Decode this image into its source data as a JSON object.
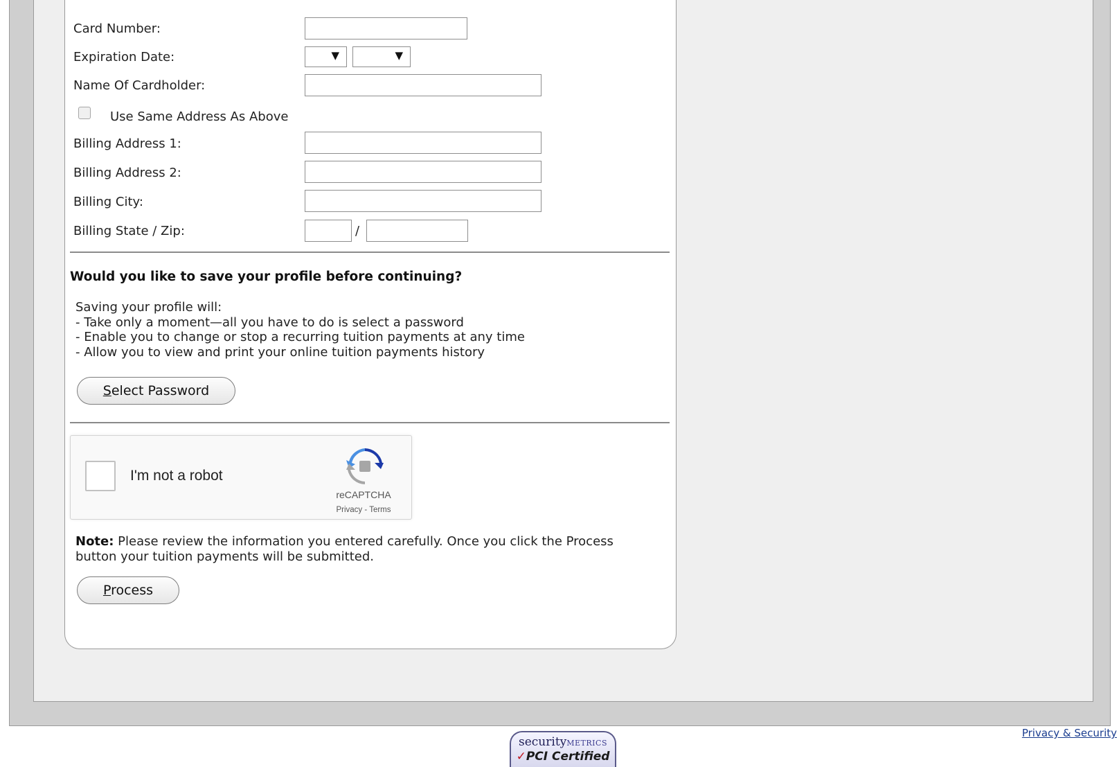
{
  "form": {
    "card_number_label": "Card Number:",
    "card_number_value": "",
    "expiration_date_label": "Expiration Date:",
    "expiration_month_value": "",
    "expiration_year_value": "",
    "cardholder_name_label": "Name Of Cardholder:",
    "cardholder_name_value": "",
    "same_address_label": "Use Same Address As Above",
    "same_address_checked": false,
    "billing_address1_label": "Billing Address 1:",
    "billing_address1_value": "",
    "billing_address2_label": "Billing Address 2:",
    "billing_address2_value": "",
    "billing_city_label": "Billing City:",
    "billing_city_value": "",
    "billing_state_zip_label": "Billing State / Zip:",
    "billing_state_value": "",
    "billing_zip_value": "",
    "state_zip_separator": "/",
    "dropdown_arrow": "▼"
  },
  "profile": {
    "heading": "Would you like to save your profile before continuing?",
    "intro": "Saving your profile will:",
    "benefits": [
      "- Take only a moment—all you have to do is select a password",
      "- Enable you to change or stop a recurring tuition payments at any time",
      "- Allow you to view and print your online tuition payments history"
    ],
    "button_accesskey": "S",
    "button_rest": "elect Password"
  },
  "recaptcha": {
    "label": "I'm not a robot",
    "brand": "reCAPTCHA",
    "links": "Privacy - Terms",
    "icon": "recaptcha-logo"
  },
  "note": {
    "bold": "Note:",
    "text": " Please review the information you entered carefully. Once you click the Process button your tuition payments will be submitted."
  },
  "process_button": {
    "accesskey": "P",
    "rest": "rocess"
  },
  "footer": {
    "badge_top_main": "security",
    "badge_top_small": "METRICS",
    "badge_check": "✓",
    "badge_bottom": "PCI Certified",
    "privacy_link": "Privacy & Security"
  },
  "colors": {
    "outer_frame": "#cfcfcf",
    "inner_panel": "#efefef",
    "form_card": "#ffffff",
    "link": "#1a3d8f",
    "recaptcha_blue": "#1c3aa9",
    "recaptcha_gray": "#a6a6a6"
  }
}
